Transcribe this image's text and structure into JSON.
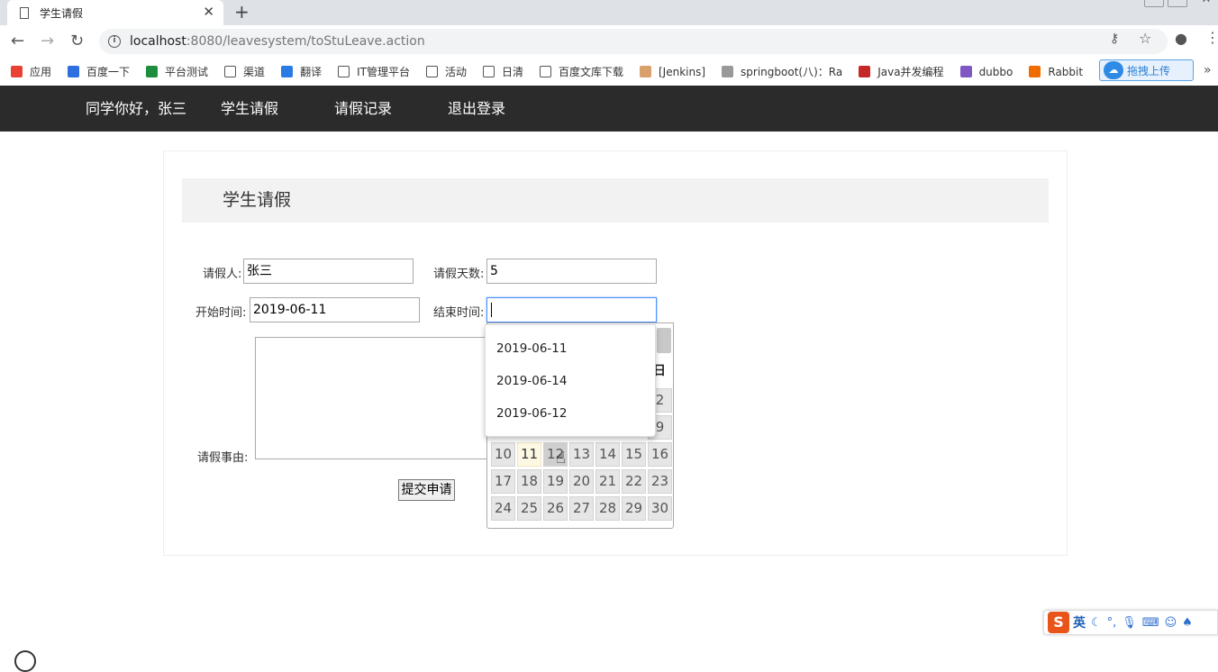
{
  "browser": {
    "tab_title": "学生请假",
    "new_tab": "+",
    "tab_close": "✕",
    "url_host": "localhost",
    "url_path": ":8080/leavesystem/toStuLeave.action"
  },
  "bookmarks": [
    {
      "label": "应用",
      "color": "#e94235"
    },
    {
      "label": "百度一下",
      "color": "#2e6fe0"
    },
    {
      "label": "平台测试",
      "color": "#1e8e3e"
    },
    {
      "label": "渠道",
      "color": "#ffffff"
    },
    {
      "label": "翻译",
      "color": "#2a7be4"
    },
    {
      "label": "IT管理平台",
      "color": "#ffffff"
    },
    {
      "label": "活动",
      "color": "#ffffff"
    },
    {
      "label": "日清",
      "color": "#ffffff"
    },
    {
      "label": "百度文库下载",
      "color": "#ffffff"
    },
    {
      "label": "[Jenkins]",
      "color": "#d9a06b"
    },
    {
      "label": "springboot(八)：Ra",
      "color": "#999999"
    },
    {
      "label": "Java并发编程",
      "color": "#c62828"
    },
    {
      "label": "dubbo",
      "color": "#7e57c2"
    },
    {
      "label": "Rabbit",
      "color": "#ef6c00"
    }
  ],
  "upload_button": "拖拽上传",
  "nav": {
    "greeting": "同学你好，张三",
    "leave": "学生请假",
    "records": "请假记录",
    "logout": "退出登录"
  },
  "form": {
    "heading": "学生请假",
    "applicant_label": "请假人:",
    "applicant_value": "张三",
    "days_label": "请假天数:",
    "days_value": "5",
    "start_label": "开始时间:",
    "start_value": "2019-06-11",
    "end_label": "结束时间:",
    "end_value": "",
    "reason_label": "请假事由:",
    "submit_label": "提交申请"
  },
  "autocomplete": [
    "2019-06-11",
    "2019-06-14",
    "2019-06-12"
  ],
  "calendar": {
    "day_header_visible": "日",
    "rows": [
      [
        "",
        "",
        "",
        "",
        "",
        "",
        "2"
      ],
      [
        "",
        "",
        "",
        "",
        "",
        "",
        "9"
      ],
      [
        "10",
        "11",
        "12",
        "13",
        "14",
        "15",
        "16"
      ],
      [
        "17",
        "18",
        "19",
        "20",
        "21",
        "22",
        "23"
      ],
      [
        "24",
        "25",
        "26",
        "27",
        "28",
        "29",
        "30"
      ]
    ],
    "today": "11",
    "hover": "12"
  },
  "ime": {
    "logo": "S",
    "mode": "英"
  }
}
